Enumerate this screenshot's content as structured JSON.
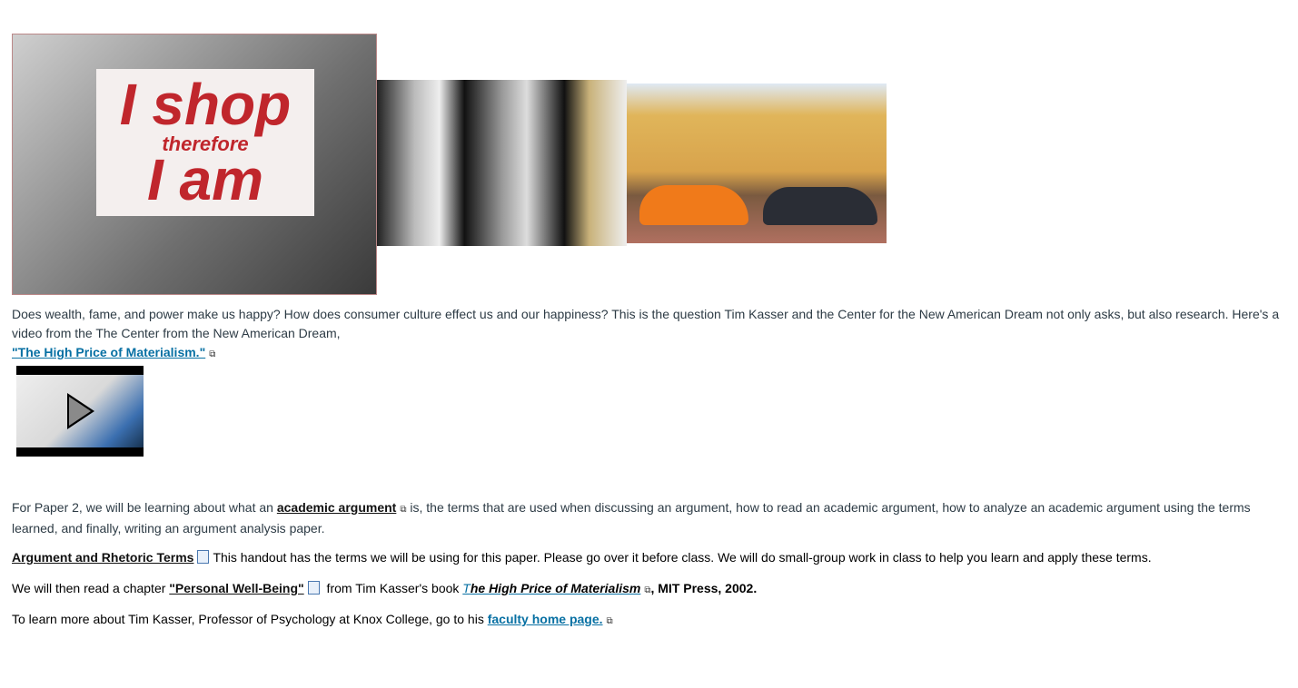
{
  "images": {
    "img1_text": [
      "I shop",
      "therefore",
      "I am"
    ]
  },
  "intro": {
    "text": "Does wealth, fame, and power make us happy? How does consumer culture effect us and our happiness? This is the question Tim Kasser and the Center for the New American Dream not only asks, but also research. Here's a video from the The Center from the New American Dream,",
    "video_link": "\"The High Price of Materialism.\""
  },
  "paper2": {
    "before": "For Paper 2, we will be learning about what an ",
    "link": "academic argument",
    "after": " is, the terms that are used when discussing an argument, how to read an academic argument, how to analyze an academic argument using the terms learned, and finally, writing an argument analysis paper."
  },
  "terms": {
    "link": "Argument and Rhetoric Terms",
    "text": "This handout has the terms we will be using for this paper. Please go over it before class. We will do small-group work in class to help you learn and apply these terms."
  },
  "chapter": {
    "before": "We will then read a chapter ",
    "link": "\"Personal Well-Being\"",
    "middle": " from Tim Kasser's book ",
    "book_first": "T",
    "book_rest": "he High Price of Materialism",
    "after": ", MIT Press, 2002."
  },
  "kasser": {
    "before": "To learn more about Tim Kasser, Professor of Psychology at Knox College, go to his ",
    "link": "faculty home page."
  }
}
